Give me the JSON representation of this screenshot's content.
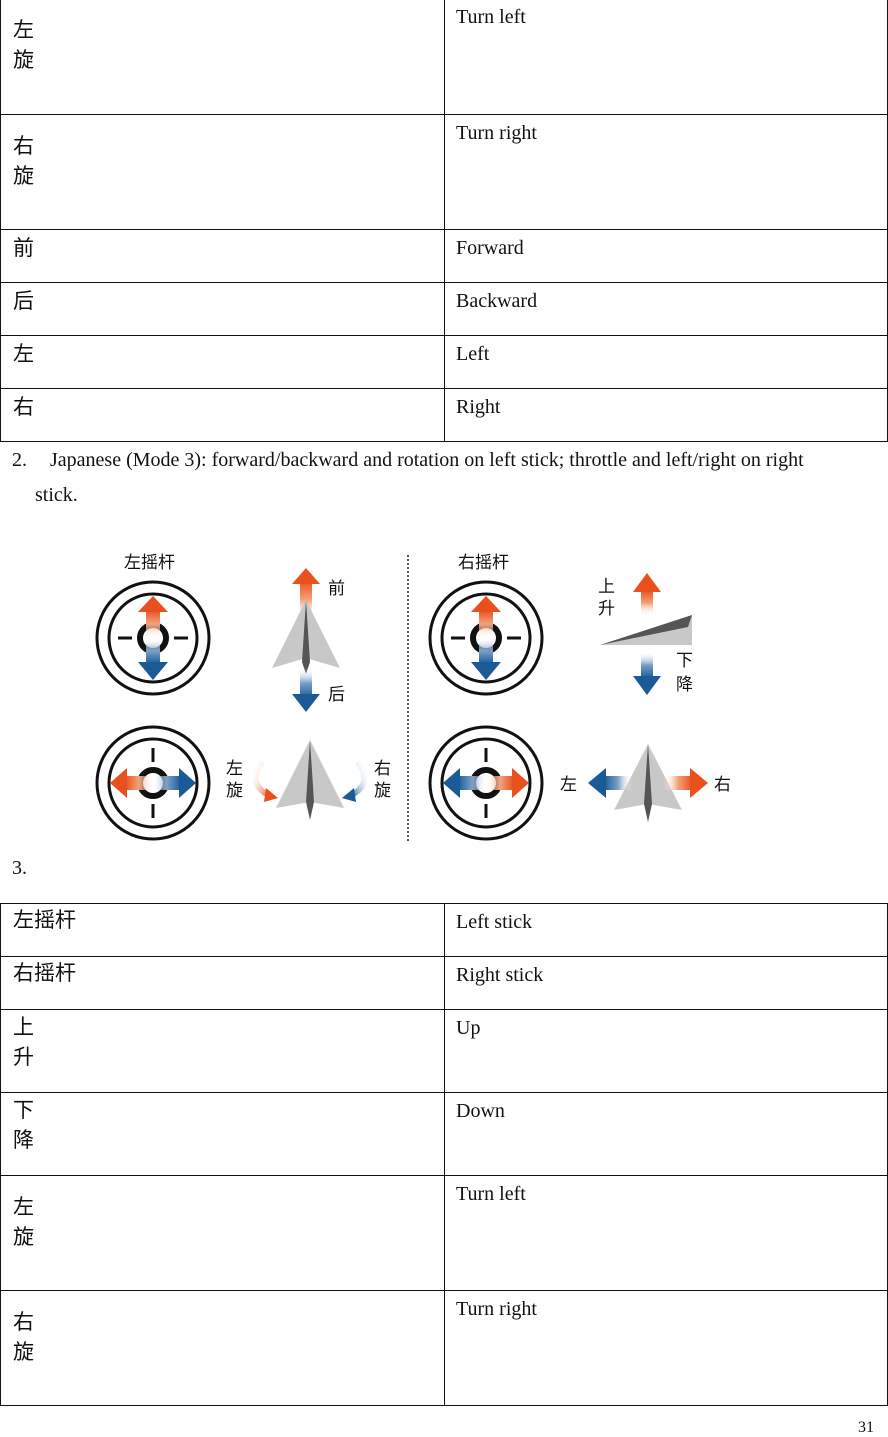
{
  "table_top": {
    "rows": [
      {
        "zh": [
          "左",
          "旋"
        ],
        "en": "Turn left"
      },
      {
        "zh": [
          "右",
          "旋"
        ],
        "en": "Turn right"
      },
      {
        "zh": [
          "前"
        ],
        "en": "Forward"
      },
      {
        "zh": [
          "后"
        ],
        "en": "Backward"
      },
      {
        "zh": [
          "左"
        ],
        "en": "Left"
      },
      {
        "zh": [
          "右"
        ],
        "en": "Right"
      }
    ]
  },
  "section2": {
    "number": "2.",
    "text": "Japanese (Mode 3): forward/backward and rotation on left stick; throttle and left/right on right",
    "continuation": "stick."
  },
  "diagram": {
    "left_stick_label": "左摇杆",
    "right_stick_label": "右摇杆",
    "forward": "前",
    "backward": "后",
    "up": [
      "上",
      "升"
    ],
    "down": [
      "下",
      "降"
    ],
    "turn_left": [
      "左",
      "旋"
    ],
    "turn_right": [
      "右",
      "旋"
    ],
    "left": "左",
    "right": "右",
    "colors": {
      "orange": "#e8501e",
      "blue": "#1a5a96",
      "plane_light": "#c8c8c8",
      "plane_dark": "#555555"
    }
  },
  "section3": {
    "number": "3."
  },
  "table_bottom": {
    "rows": [
      {
        "zh": [
          "左摇杆"
        ],
        "en": "Left stick"
      },
      {
        "zh": [
          "右摇杆"
        ],
        "en": "Right stick"
      },
      {
        "zh": [
          "上",
          "升"
        ],
        "en": "Up"
      },
      {
        "zh": [
          "下",
          "降"
        ],
        "en": "Down"
      },
      {
        "zh": [
          "左",
          "旋"
        ],
        "en": "Turn left"
      },
      {
        "zh": [
          "右",
          "旋"
        ],
        "en": "Turn right"
      }
    ]
  },
  "page_number": "31"
}
